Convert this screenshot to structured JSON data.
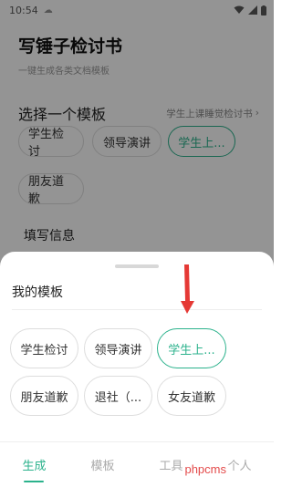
{
  "status": {
    "time": "10:54"
  },
  "page": {
    "title": "写锤子检讨书",
    "subtitle": "一键生成各类文档模板",
    "section_title": "选择一个模板",
    "section_link": "学生上课睡觉检讨书",
    "chips": [
      "学生检讨",
      "领导演讲",
      "学生上...",
      "朋友道歉"
    ],
    "fill_info": "填写信息"
  },
  "sheet": {
    "title": "我的模板",
    "chips": [
      "学生检讨",
      "领导演讲",
      "学生上...",
      "朋友道歉",
      "退社（...",
      "女友道歉"
    ]
  },
  "tabs": [
    "生成",
    "模板",
    "工具",
    "个人"
  ],
  "watermark": "phpcms",
  "colors": {
    "accent": "#2bb28c",
    "arrow": "#e53935"
  }
}
